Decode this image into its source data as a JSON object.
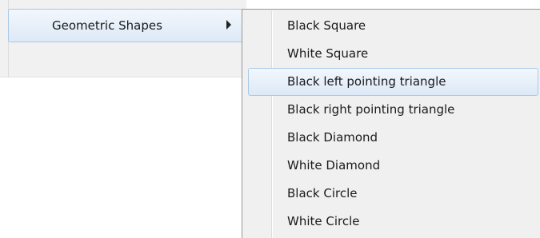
{
  "parent_menu": {
    "item": {
      "label": "Geometric Shapes",
      "arrow_icon": "submenu-arrow-right"
    }
  },
  "submenu": {
    "hovered_index": 2,
    "items": [
      {
        "label": "Black Square"
      },
      {
        "label": "White Square"
      },
      {
        "label": "Black left pointing triangle"
      },
      {
        "label": "Black right pointing triangle"
      },
      {
        "label": "Black Diamond"
      },
      {
        "label": "White Diamond"
      },
      {
        "label": "Black Circle"
      },
      {
        "label": "White Circle"
      }
    ]
  },
  "colors": {
    "menu_background": "#f0f0f0",
    "highlight_border": "#a8c8e8",
    "highlight_fill": "#dde9f6",
    "text": "#1a1a1a"
  }
}
